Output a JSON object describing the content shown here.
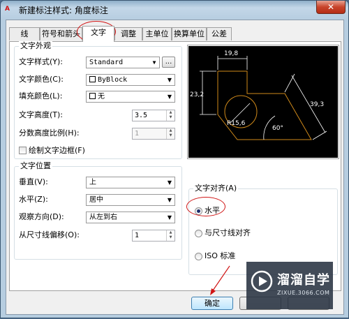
{
  "window": {
    "title": "新建标注样式: 角度标注",
    "app_icon_text": "A",
    "close_symbol": "✕"
  },
  "tabs": [
    {
      "label": "线"
    },
    {
      "label": "符号和箭头"
    },
    {
      "label": "文字",
      "active": true
    },
    {
      "label": "调整"
    },
    {
      "label": "主单位"
    },
    {
      "label": "换算单位"
    },
    {
      "label": "公差"
    }
  ],
  "text_appearance": {
    "group_title": "文字外观",
    "style_label": "文字样式(Y):",
    "style_value": "Standard",
    "style_browse_label": "...",
    "color_label": "文字颜色(C):",
    "color_value": "ByBlock",
    "fill_label": "填充颜色(L):",
    "fill_value": "无",
    "height_label": "文字高度(T):",
    "height_value": "3.5",
    "fraction_label": "分数高度比例(H):",
    "fraction_value": "1",
    "frame_label": "绘制文字边框(F)"
  },
  "text_placement": {
    "group_title": "文字位置",
    "vertical_label": "垂直(V):",
    "vertical_value": "上",
    "horizontal_label": "水平(Z):",
    "horizontal_value": "居中",
    "view_direction_label": "观察方向(D):",
    "view_direction_value": "从左到右",
    "offset_label": "从尺寸线偏移(O):",
    "offset_value": "1"
  },
  "text_alignment": {
    "group_title": "文字对齐(A)",
    "options": [
      {
        "label": "水平",
        "checked": true
      },
      {
        "label": "与尺寸线对齐",
        "checked": false
      },
      {
        "label": "ISO 标准",
        "checked": false
      }
    ]
  },
  "preview": {
    "dim_top": "19,8",
    "dim_left": "23,2",
    "dim_diag": "39,3",
    "dim_radius": "R15,6",
    "dim_angle": "60°",
    "line_color": "#d08a1a",
    "dim_color": "#ffffff"
  },
  "buttons": {
    "ok_label": "确定"
  },
  "annotation_color": "#d01515",
  "watermark": {
    "name": "溜溜自学",
    "url": "ZIXUE.3066.COM"
  }
}
